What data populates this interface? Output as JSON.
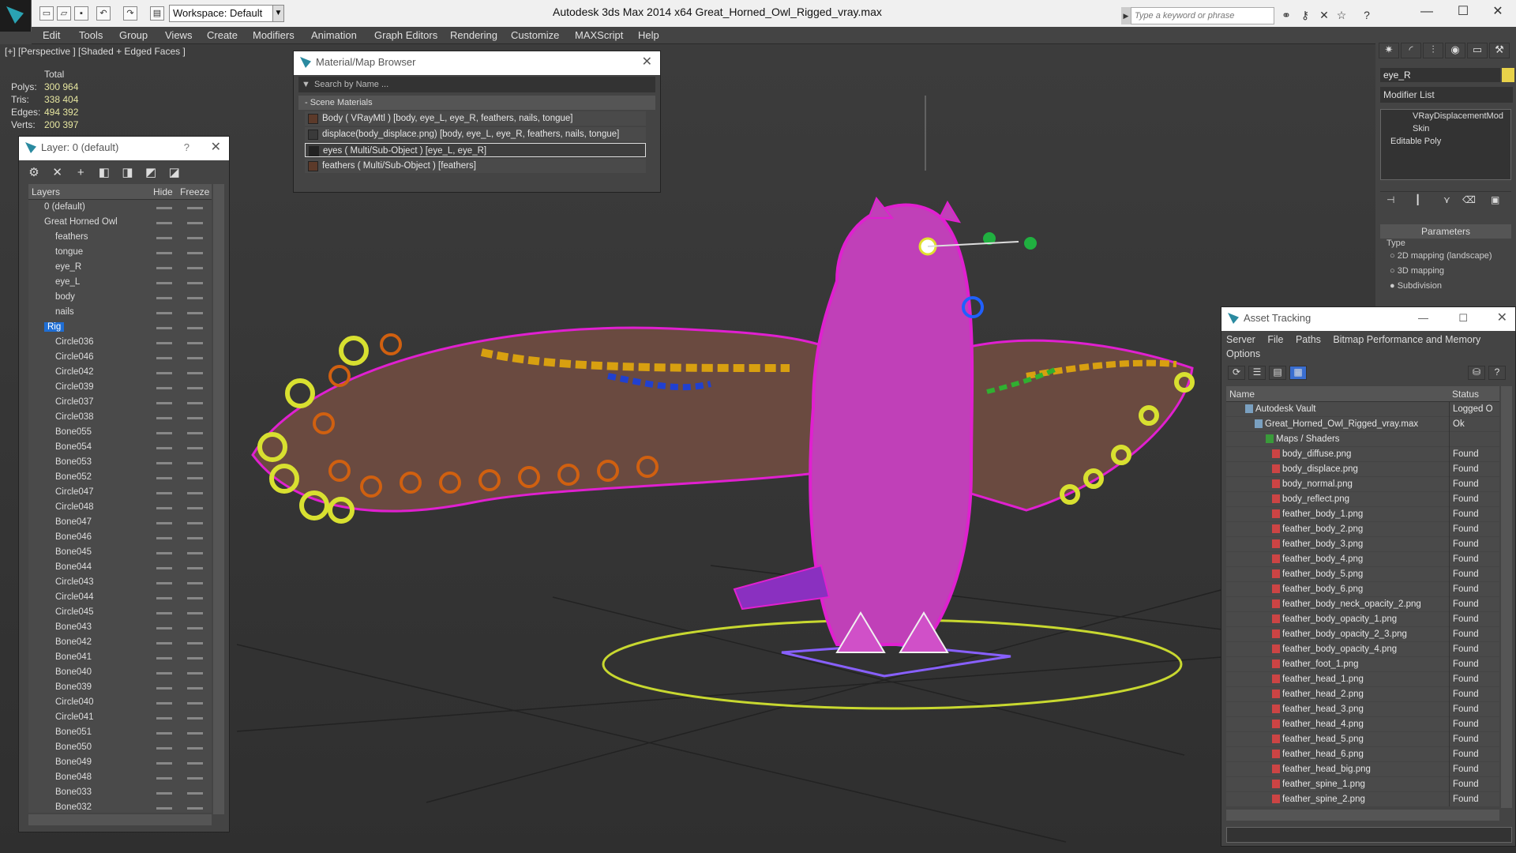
{
  "titlebar": {
    "workspace": "Workspace: Default",
    "app_title": "Autodesk 3ds Max  2014 x64      Great_Horned_Owl_Rigged_vray.max",
    "search_placeholder": "Type a keyword or phrase"
  },
  "menu": [
    "Edit",
    "Tools",
    "Group",
    "Views",
    "Create",
    "Modifiers",
    "Animation",
    "Graph Editors",
    "Rendering",
    "Customize",
    "MAXScript",
    "Help"
  ],
  "viewport": {
    "label": "[+] [Perspective ] [Shaded + Edged Faces ]",
    "stats": {
      "header": "Total",
      "rows": [
        {
          "k": "Polys:",
          "v": "300 964"
        },
        {
          "k": "Tris:",
          "v": "338 404"
        },
        {
          "k": "Edges:",
          "v": "494 392"
        },
        {
          "k": "Verts:",
          "v": "200 397"
        }
      ]
    }
  },
  "layer_panel": {
    "title": "Layer: 0 (default)",
    "help": "?",
    "col_layers": "Layers",
    "col_hide": "Hide",
    "col_freeze": "Freeze",
    "rows": [
      "0 (default)",
      "Great Horned Owl",
      "feathers",
      "tongue",
      "eye_R",
      "eye_L",
      "body",
      "nails",
      "Rig",
      "Circle036",
      "Circle046",
      "Circle042",
      "Circle039",
      "Circle037",
      "Circle038",
      "Bone055",
      "Bone054",
      "Bone053",
      "Bone052",
      "Circle047",
      "Circle048",
      "Bone047",
      "Bone046",
      "Bone045",
      "Bone044",
      "Circle043",
      "Circle044",
      "Circle045",
      "Bone043",
      "Bone042",
      "Bone041",
      "Bone040",
      "Bone039",
      "Circle040",
      "Circle041",
      "Bone051",
      "Bone050",
      "Bone049",
      "Bone048",
      "Bone033",
      "Bone032"
    ]
  },
  "material_browser": {
    "title": "Material/Map Browser",
    "search": "Search by Name ...",
    "section": "- Scene Materials",
    "rows": [
      "Body  ( VRayMtl ) [body, eye_L, eye_R, feathers, nails, tongue]",
      "displace(body_displace.png) [body, eye_L, eye_R, feathers, nails, tongue]",
      "eyes  ( Multi/Sub-Object ) [eye_L, eye_R]",
      "feathers  ( Multi/Sub-Object ) [feathers]"
    ]
  },
  "command_panel": {
    "object_name": "eye_R",
    "modifier_list": "Modifier List",
    "stack": [
      "VRayDisplacementMod",
      "Skin",
      "Editable Poly"
    ],
    "parameters": "Parameters",
    "type_label": "Type",
    "options": [
      "2D mapping (landscape)",
      "3D mapping",
      "Subdivision"
    ]
  },
  "asset_tracking": {
    "title": "Asset Tracking",
    "menu": [
      "Server",
      "File",
      "Paths",
      "Bitmap Performance and Memory",
      "Options"
    ],
    "col_name": "Name",
    "col_status": "Status",
    "rows": [
      {
        "n": "Autodesk Vault",
        "s": "Logged O"
      },
      {
        "n": "Great_Horned_Owl_Rigged_vray.max",
        "s": "Ok"
      },
      {
        "n": "Maps / Shaders",
        "s": ""
      },
      {
        "n": "body_diffuse.png",
        "s": "Found"
      },
      {
        "n": "body_displace.png",
        "s": "Found"
      },
      {
        "n": "body_normal.png",
        "s": "Found"
      },
      {
        "n": "body_reflect.png",
        "s": "Found"
      },
      {
        "n": "feather_body_1.png",
        "s": "Found"
      },
      {
        "n": "feather_body_2.png",
        "s": "Found"
      },
      {
        "n": "feather_body_3.png",
        "s": "Found"
      },
      {
        "n": "feather_body_4.png",
        "s": "Found"
      },
      {
        "n": "feather_body_5.png",
        "s": "Found"
      },
      {
        "n": "feather_body_6.png",
        "s": "Found"
      },
      {
        "n": "feather_body_neck_opacity_2.png",
        "s": "Found"
      },
      {
        "n": "feather_body_opacity_1.png",
        "s": "Found"
      },
      {
        "n": "feather_body_opacity_2_3.png",
        "s": "Found"
      },
      {
        "n": "feather_body_opacity_4.png",
        "s": "Found"
      },
      {
        "n": "feather_foot_1.png",
        "s": "Found"
      },
      {
        "n": "feather_head_1.png",
        "s": "Found"
      },
      {
        "n": "feather_head_2.png",
        "s": "Found"
      },
      {
        "n": "feather_head_3.png",
        "s": "Found"
      },
      {
        "n": "feather_head_4.png",
        "s": "Found"
      },
      {
        "n": "feather_head_5.png",
        "s": "Found"
      },
      {
        "n": "feather_head_6.png",
        "s": "Found"
      },
      {
        "n": "feather_head_big.png",
        "s": "Found"
      },
      {
        "n": "feather_spine_1.png",
        "s": "Found"
      },
      {
        "n": "feather_spine_2.png",
        "s": "Found"
      }
    ]
  },
  "colors": {
    "owl_wire": "#e020d0",
    "selection": "#1f6ed4",
    "helper": "#d8e030"
  }
}
